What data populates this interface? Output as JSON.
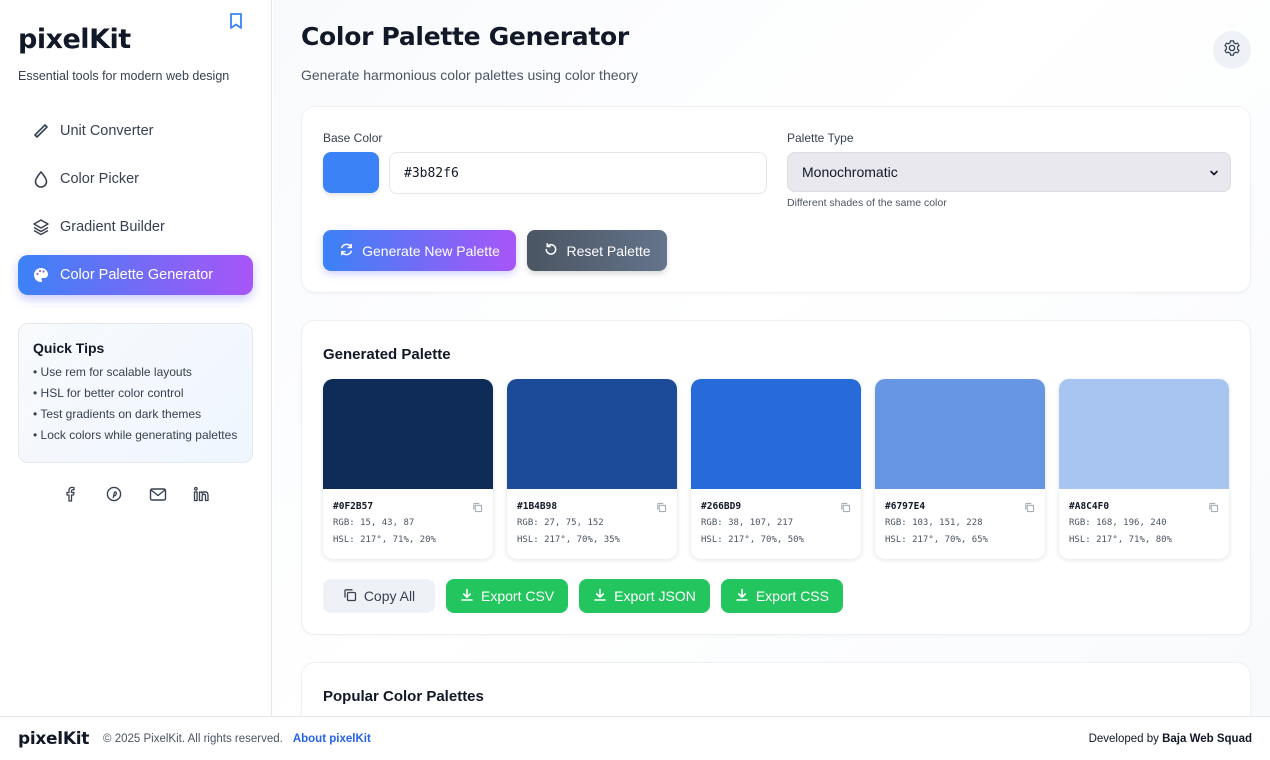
{
  "brand": {
    "name": "pixelKit",
    "tagline": "Essential tools for modern web design"
  },
  "sidebar": {
    "items": [
      {
        "label": "Unit Converter",
        "icon": "ruler-icon"
      },
      {
        "label": "Color Picker",
        "icon": "droplet-icon"
      },
      {
        "label": "Gradient Builder",
        "icon": "layers-icon"
      },
      {
        "label": "Color Palette Generator",
        "icon": "palette-icon",
        "active": true
      }
    ],
    "tips": {
      "title": "Quick Tips",
      "items": [
        "• Use rem for scalable layouts",
        "• HSL for better color control",
        "• Test gradients on dark themes",
        "• Lock colors while generating palettes"
      ]
    },
    "socials": [
      "facebook-icon",
      "pinterest-icon",
      "mail-icon",
      "linkedin-icon"
    ]
  },
  "header": {
    "title": "Color Palette Generator",
    "subtitle": "Generate harmonious color palettes using color theory"
  },
  "controls": {
    "base_color_label": "Base Color",
    "base_color_value": "#3b82f6",
    "palette_type_label": "Palette Type",
    "palette_type_value": "Monochromatic",
    "palette_type_hint": "Different shades of the same color",
    "generate_label": "Generate New Palette",
    "reset_label": "Reset Palette"
  },
  "palette": {
    "title": "Generated Palette",
    "colors": [
      {
        "hex": "#0F2B57",
        "rgb": "RGB: 15, 43, 87",
        "hsl": "HSL: 217°, 71%, 20%"
      },
      {
        "hex": "#1B4B98",
        "rgb": "RGB: 27, 75, 152",
        "hsl": "HSL: 217°, 70%, 35%"
      },
      {
        "hex": "#266BD9",
        "rgb": "RGB: 38, 107, 217",
        "hsl": "HSL: 217°, 70%, 50%"
      },
      {
        "hex": "#6797E4",
        "rgb": "RGB: 103, 151, 228",
        "hsl": "HSL: 217°, 70%, 65%"
      },
      {
        "hex": "#A8C4F0",
        "rgb": "RGB: 168, 196, 240",
        "hsl": "HSL: 217°, 71%, 80%"
      }
    ],
    "copy_all_label": "Copy All",
    "export_csv_label": "Export CSV",
    "export_json_label": "Export JSON",
    "export_css_label": "Export CSS"
  },
  "popular": {
    "title": "Popular Color Palettes"
  },
  "footer": {
    "logo": "pixelKit",
    "copyright": "© 2025 PixelKit. All rights reserved.",
    "about": "About pixelKit",
    "developed_prefix": "Developed by",
    "developer": "Baja Web Squad"
  },
  "colors": {
    "accent_start": "#3b82f6",
    "accent_end": "#a855f7",
    "export_green": "#22c55e",
    "link_blue": "#2563eb"
  }
}
